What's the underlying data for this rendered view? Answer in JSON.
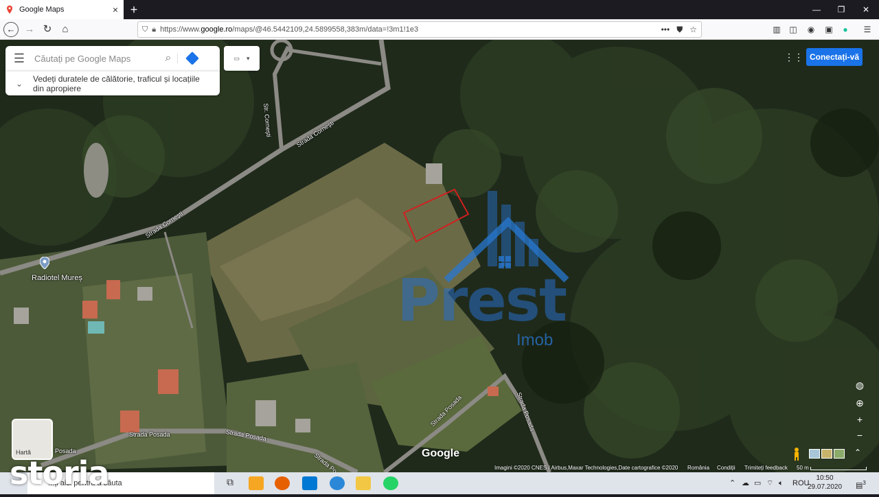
{
  "browser": {
    "tab_title": "Google Maps",
    "tab_close": "×",
    "new_tab": "+",
    "url_prefix": "https://www.",
    "url_domain": "google.ro",
    "url_path": "/maps/@46.5442109,24.5899558,383m/data=!3m1!1e3",
    "page_actions": "•••",
    "window_min": "—",
    "window_max": "❐",
    "window_close": "✕"
  },
  "maps": {
    "search_placeholder": "Căutați pe Google Maps",
    "subbar_text": "Vedeți duratele de călătorie, traficul și locațiile din apropiere",
    "signin_label": "Conectați-vă",
    "poi_label": "Radiotel Mureș",
    "minimap_label": "Hartă",
    "google_logo": "Google",
    "roads": {
      "corneti_vertical": "Str. Cornești",
      "corneti_upper": "Strada Cornești",
      "corneti_lower": "Strada Cornești",
      "posada_1": "Strada Posada",
      "posada_2": "Strada Posada",
      "posada_3": "Strada Posada",
      "posada_4": "Strada Posada",
      "posada_5": "Posada",
      "posada_6": "Strada Po"
    },
    "credits": {
      "imagery": "Imagini ©2020 CNES / Airbus,Maxar Technologies,Date cartografice ©2020",
      "country": "România",
      "terms": "Condiții",
      "feedback": "Trimiteți feedback",
      "scale": "50 m"
    },
    "controls": {
      "zoom_in": "+",
      "zoom_out": "−"
    }
  },
  "watermark": {
    "brand": "Prest",
    "sub": "Imob",
    "site": "storia"
  },
  "taskbar": {
    "search_text": "...ți aici pentru a căuta",
    "language": "ROU",
    "time": "10:50",
    "date": "29.07.2020",
    "notification_count": "3"
  }
}
